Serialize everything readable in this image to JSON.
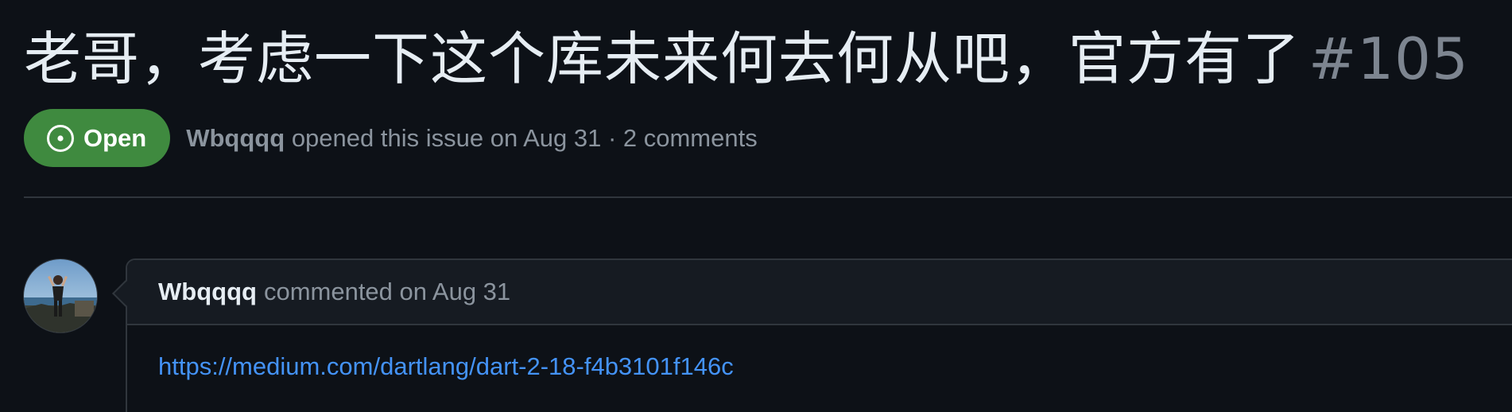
{
  "issue": {
    "title": "老哥，考虑一下这个库未来何去何从吧，官方有了",
    "number": "#105",
    "state": "Open",
    "state_color": "#3f8a3f",
    "author": "Wbqqqq",
    "meta_suffix": "opened this issue on Aug 31 · 2 comments"
  },
  "comment": {
    "author": "Wbqqqq",
    "header_suffix": "commented on Aug 31",
    "avatar_icon": "user-avatar",
    "link_text": "https://medium.com/dartlang/dart-2-18-f4b3101f146c",
    "link_color": "#4493f8"
  }
}
